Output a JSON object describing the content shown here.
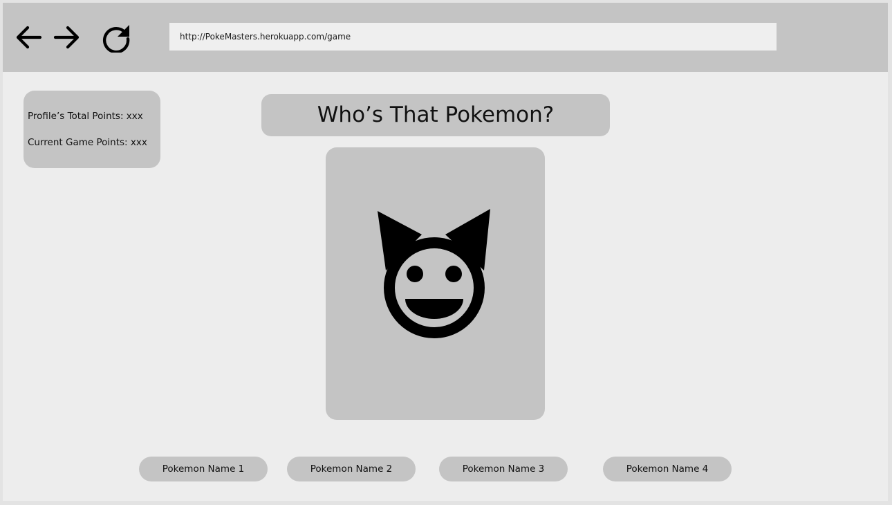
{
  "browser": {
    "url": "http://PokeMasters.herokuapp.com/game",
    "icons": {
      "back": "arrow-left-icon",
      "forward": "arrow-right-icon",
      "reload": "reload-icon"
    }
  },
  "points": {
    "total_label": "Profile’s Total Points: xxx",
    "current_label": "Current Game Points: xxx"
  },
  "game": {
    "title": "Who’s That Pokemon?",
    "image_icon": "cat-face-icon"
  },
  "answers": [
    {
      "label": "Pokemon Name 1"
    },
    {
      "label": "Pokemon Name 2"
    },
    {
      "label": "Pokemon Name 3"
    },
    {
      "label": "Pokemon Name 4"
    }
  ],
  "colors": {
    "panel": "#c4c4c4",
    "background": "#ededed",
    "text": "#111111"
  }
}
